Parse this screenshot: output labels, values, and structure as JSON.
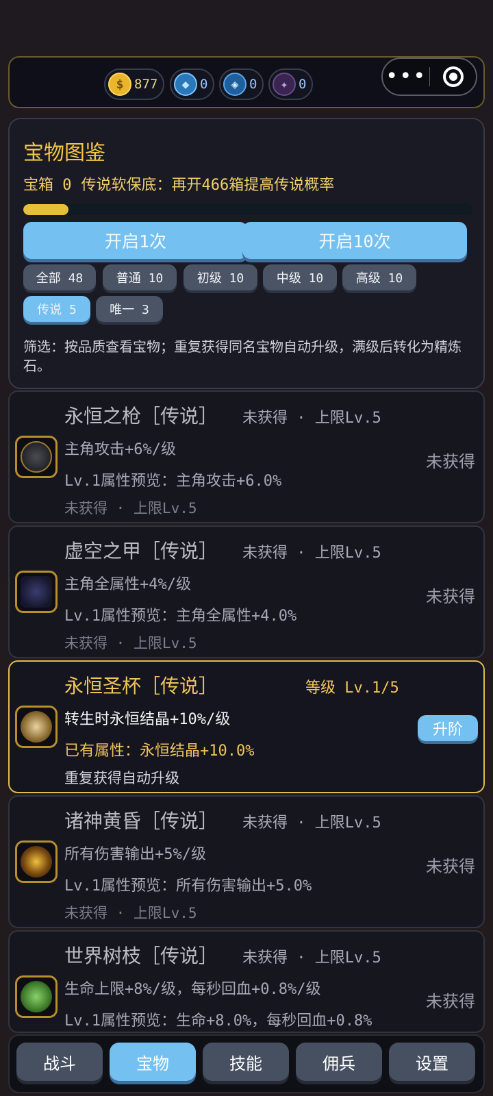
{
  "resources": [
    {
      "icon": "gold-coin-icon",
      "symbol": "$",
      "value": "877"
    },
    {
      "icon": "blue-hex-gem-icon",
      "symbol": "◆",
      "value": "0"
    },
    {
      "icon": "blue-diamond-gem-icon",
      "symbol": "◈",
      "value": "0"
    },
    {
      "icon": "purple-crystal-icon",
      "symbol": "✦",
      "value": "0"
    }
  ],
  "panel": {
    "title": "宝物图鉴",
    "box_label": "宝箱 0",
    "pity_text": "传说软保底：再开466箱提高传说概率",
    "progress": 0.1,
    "open_once": "开启1次",
    "open_ten": "开启10次",
    "filters": [
      "全部 48",
      "普通 10",
      "初级 10",
      "中级 10",
      "高级 10",
      "传说 5",
      "唯一 3"
    ],
    "active_filter": "传说 5",
    "description": "筛选：按品质查看宝物；重复获得同名宝物自动升级，满级后转化为精炼石。"
  },
  "items": [
    {
      "name": "永恒之枪［传说］",
      "meta": "未获得 · 上限Lv.5",
      "line1": "主角攻击+6%/级",
      "line2": "Lv.1属性预览：主角攻击+6.0%",
      "line3": "未获得 · 上限Lv.5",
      "side": "未获得",
      "icon": "spear-icon"
    },
    {
      "name": "虚空之甲［传说］",
      "meta": "未获得 · 上限Lv.5",
      "line1": "主角全属性+4%/级",
      "line2": "Lv.1属性预览：主角全属性+4.0%",
      "line3": "未获得 · 上限Lv.5",
      "side": "未获得",
      "icon": "armor-icon"
    },
    {
      "name": "永恒圣杯［传说］",
      "meta": "等级 Lv.1/5",
      "line1": "转生时永恒结晶+10%/级",
      "line2": "已有属性：永恒结晶+10.0%",
      "line3": "重复获得自动升级",
      "side": "升阶",
      "icon": "grail-icon"
    },
    {
      "name": "诸神黄昏［传说］",
      "meta": "未获得 · 上限Lv.5",
      "line1": "所有伤害输出+5%/级",
      "line2": "Lv.1属性预览：所有伤害输出+5.0%",
      "line3": "未获得 · 上限Lv.5",
      "side": "未获得",
      "icon": "ragnarok-icon"
    },
    {
      "name": "世界树枝［传说］",
      "meta": "未获得 · 上限Lv.5",
      "line1": "生命上限+8%/级，每秒回血+0.8%/级",
      "line2": "Lv.1属性预览：生命+8.0%，每秒回血+0.8%",
      "line3": "",
      "side": "未获得",
      "icon": "world-tree-branch-icon"
    }
  ],
  "nav": [
    "战斗",
    "宝物",
    "技能",
    "佣兵",
    "设置"
  ],
  "active_nav": "宝物",
  "colors": {
    "accent": "#74c0f0",
    "gold": "#f2c744",
    "border_owned": "#e0bb4f"
  }
}
